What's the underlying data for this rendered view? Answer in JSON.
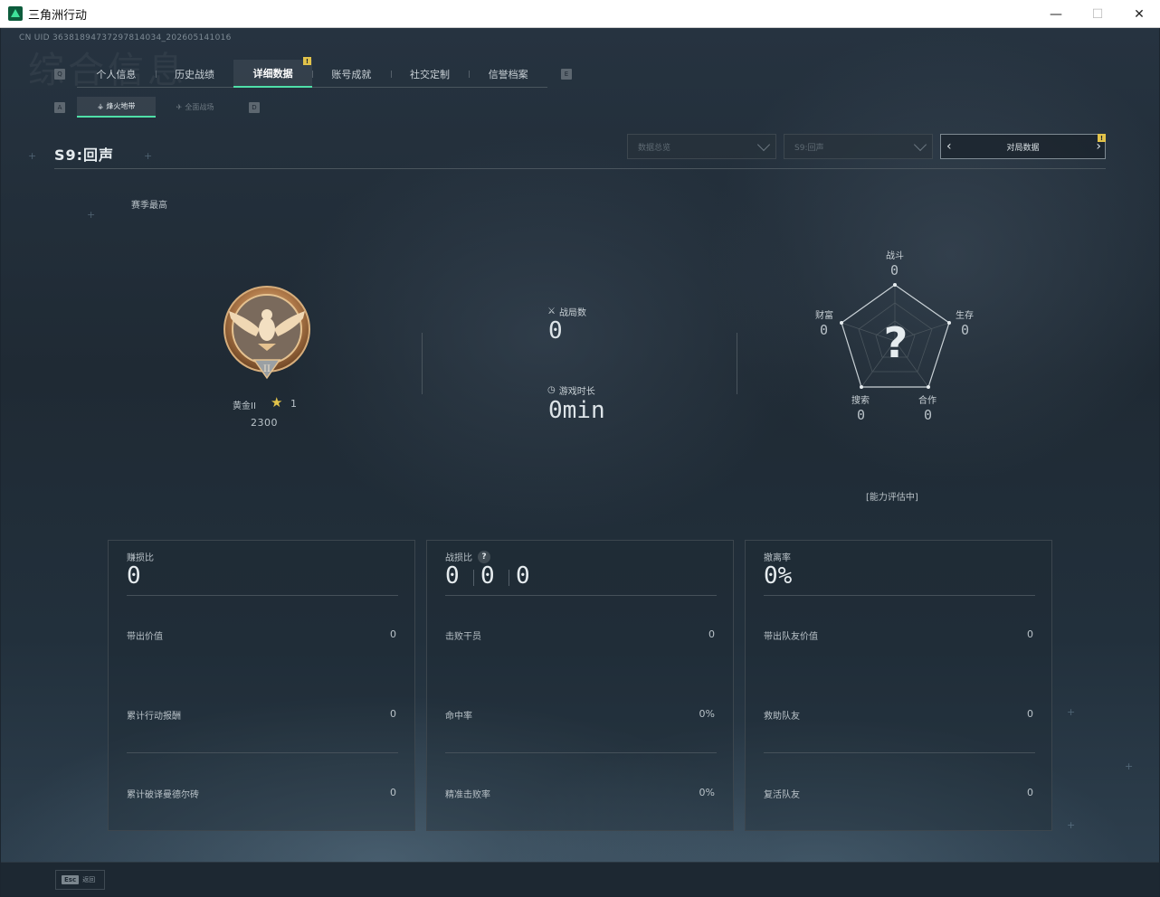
{
  "window": {
    "title": "三角洲行动",
    "minimize": "—",
    "maximize": "☐",
    "close": "✕"
  },
  "uid": "CN UID 3638189473729781403​4_202605141016",
  "watermark": "综合信息",
  "main_tabs": {
    "key_left": "Q",
    "key_right": "E",
    "items": [
      {
        "label": "个人信息"
      },
      {
        "label": "历史战绩"
      },
      {
        "label": "详细数据",
        "active": true,
        "badge": "!"
      },
      {
        "label": "账号成就"
      },
      {
        "label": "社交定制"
      },
      {
        "label": "信誉档案"
      }
    ]
  },
  "sub_tabs": {
    "key_left": "A",
    "key_right": "D",
    "items": [
      {
        "label": "烽火地带",
        "active": true
      },
      {
        "label": "全面战场"
      }
    ]
  },
  "season": {
    "title": "S9:回声",
    "best_label": "赛季最高"
  },
  "filters": {
    "dropdown1": "数据总览",
    "dropdown2": "S9:回声",
    "nav_label": "对局数据",
    "nav_prev": "‹",
    "nav_next": "›",
    "nav_badge": "!"
  },
  "rank": {
    "name": "黄金II",
    "stars": "1",
    "score": "2300",
    "numeral": "II"
  },
  "battle": {
    "games_label": "战局数",
    "games_value": "0",
    "time_label": "游戏时长",
    "time_value": "0min"
  },
  "radar": {
    "center": "?",
    "combat_label": "战斗",
    "combat_value": "0",
    "survival_label": "生存",
    "survival_value": "0",
    "wealth_label": "财富",
    "wealth_value": "0",
    "search_label": "搜索",
    "search_value": "0",
    "coop_label": "合作",
    "coop_value": "0",
    "evaluating": "[能力评估中]"
  },
  "cards": [
    {
      "title": "赚损比",
      "main": "0",
      "rows": [
        {
          "label": "带出价值",
          "value": "0"
        },
        {
          "label": "累计行动报酬",
          "value": "0"
        },
        {
          "label": "累计破译曼德尔砖",
          "value": "0"
        }
      ]
    },
    {
      "title": "战损比",
      "help": "?",
      "main_multi": [
        "0",
        "0",
        "0"
      ],
      "rows": [
        {
          "label": "击败干员",
          "value": "0"
        },
        {
          "label": "命中率",
          "value": "0%"
        },
        {
          "label": "精准击败率",
          "value": "0%"
        }
      ]
    },
    {
      "title": "撤离率",
      "main": "0%",
      "rows": [
        {
          "label": "带出队友价值",
          "value": "0"
        },
        {
          "label": "救助队友",
          "value": "0"
        },
        {
          "label": "复活队友",
          "value": "0"
        }
      ]
    }
  ],
  "bottom": {
    "esc_key": "Esc",
    "esc_label": "返回"
  },
  "colors": {
    "accent": "#4fe0a8",
    "badge": "#e2c34a",
    "bg": "#1c2630"
  }
}
